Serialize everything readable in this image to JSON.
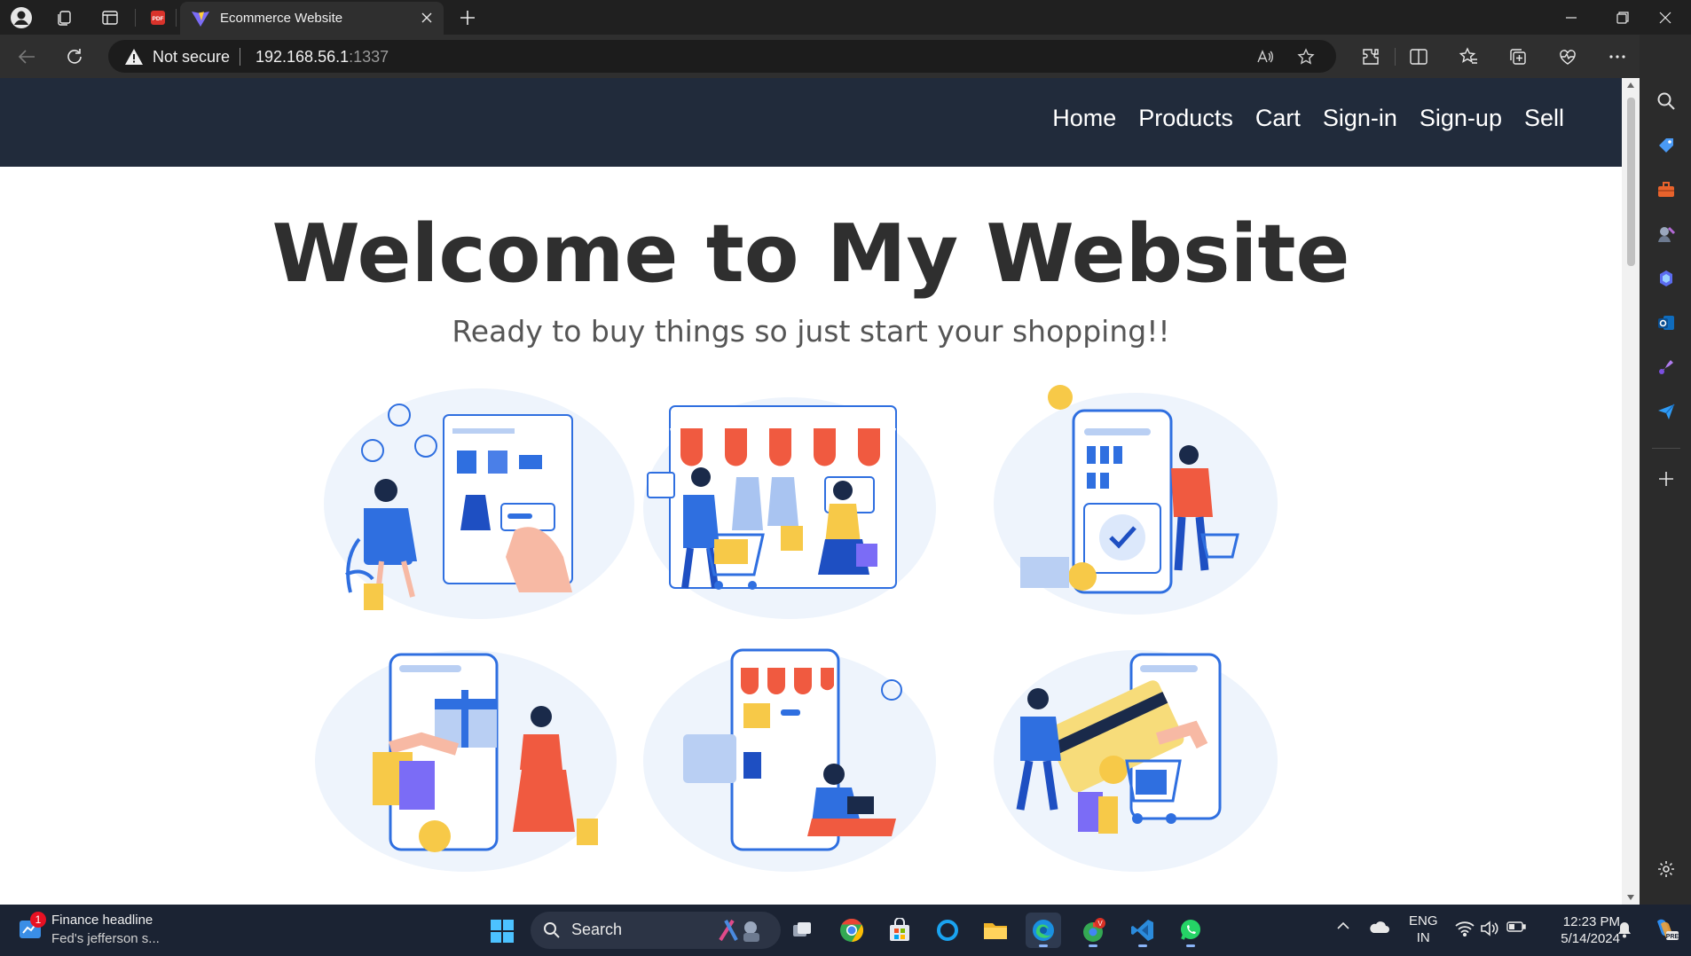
{
  "browser": {
    "tab_title": "Ecommerce Website",
    "security_label": "Not secure",
    "url_host": "192.168.56.1",
    "url_port": ":1337"
  },
  "site": {
    "nav": [
      "Home",
      "Products",
      "Cart",
      "Sign-in",
      "Sign-up",
      "Sell"
    ],
    "hero_title": "Welcome to My Website",
    "hero_subtitle": "Ready to buy things so just start your shopping!!"
  },
  "taskbar": {
    "widget_title": "Finance headline",
    "widget_sub": "Fed's jefferson s...",
    "widget_badge": "1",
    "search_label": "Search",
    "lang_line1": "ENG",
    "lang_line2": "IN",
    "time": "12:23 PM",
    "date": "5/14/2024"
  },
  "colors": {
    "site_nav": "#212b3b",
    "accent_blue": "#2f6fe0",
    "awning_red": "#f05a40",
    "shopping_yellow": "#f7c948"
  }
}
